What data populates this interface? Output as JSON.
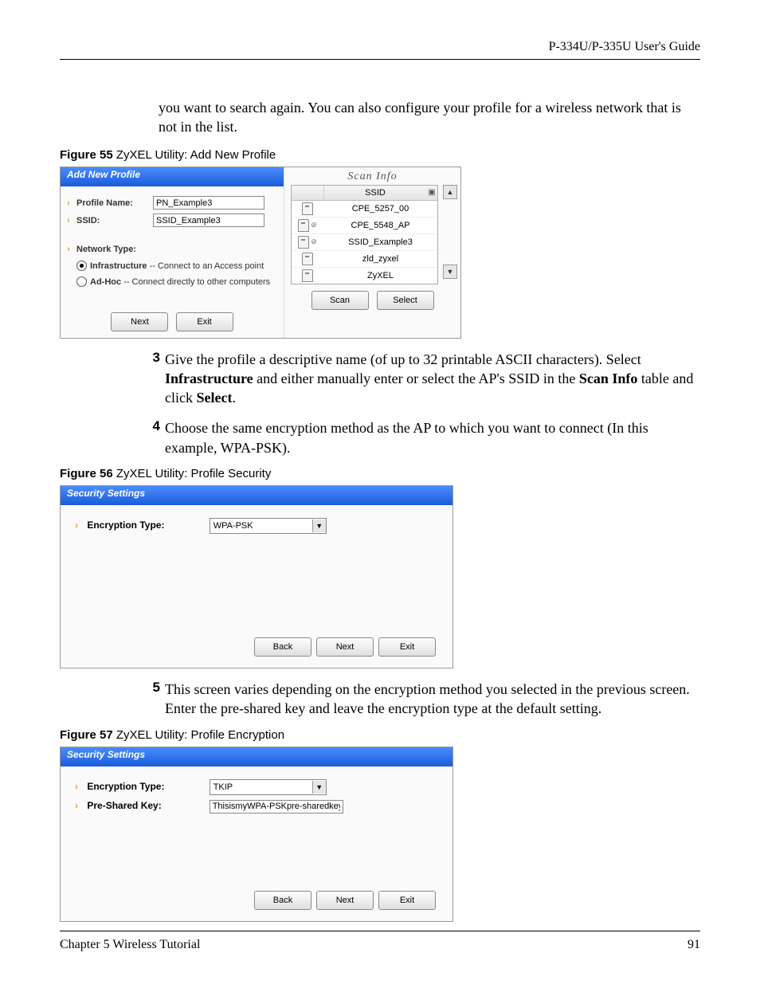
{
  "header": {
    "guide": "P-334U/P-335U User's Guide"
  },
  "intro_continuation": "you want to search again. You can also configure your profile for a wireless network that is not in the list.",
  "fig55": {
    "caption_bold": "Figure 55",
    "caption_rest": "   ZyXEL Utility: Add New Profile",
    "left": {
      "title": "Add New Profile",
      "profile_name_label": "Profile Name:",
      "profile_name_value": "PN_Example3",
      "ssid_label": "SSID:",
      "ssid_value": "SSID_Example3",
      "network_type_label": "Network Type:",
      "radio_infra_bold": "Infrastructure",
      "radio_infra_rest": " -- Connect to an Access point",
      "radio_adhoc_bold": "Ad-Hoc",
      "radio_adhoc_rest": " -- Connect directly to other computers",
      "next": "Next",
      "exit": "Exit"
    },
    "right": {
      "title": "Scan Info",
      "col_ssid": "SSID",
      "rows": [
        {
          "ssid": "CPE_5257_00",
          "locked": false
        },
        {
          "ssid": "CPE_5548_AP",
          "locked": true
        },
        {
          "ssid": "SSID_Example3",
          "locked": true
        },
        {
          "ssid": "zld_zyxel",
          "locked": false
        },
        {
          "ssid": "ZyXEL",
          "locked": false
        }
      ],
      "scan": "Scan",
      "select": "Select"
    }
  },
  "step3": {
    "num": "3",
    "t1": "Give the profile a descriptive name (of up to 32 printable ASCII characters). Select ",
    "b1": "Infrastructure",
    "t2": " and either manually enter or select the AP's SSID in the ",
    "b2": "Scan Info",
    "t3": " table and click ",
    "b3": "Select",
    "t4": "."
  },
  "step4": {
    "num": "4",
    "text": "Choose the same encryption method as the AP to which you want to connect (In this example, WPA-PSK)."
  },
  "fig56": {
    "caption_bold": "Figure 56",
    "caption_rest": "   ZyXEL Utility: Profile Security",
    "title": "Security Settings",
    "enc_label": "Encryption Type:",
    "enc_value": "WPA-PSK",
    "back": "Back",
    "next": "Next",
    "exit": "Exit"
  },
  "step5": {
    "num": "5",
    "text": "This screen varies depending on the encryption method you selected in the previous screen. Enter the pre-shared key and leave the encryption type at the default setting."
  },
  "fig57": {
    "caption_bold": "Figure 57",
    "caption_rest": "   ZyXEL Utility: Profile Encryption",
    "title": "Security Settings",
    "enc_label": "Encryption Type:",
    "enc_value": "TKIP",
    "psk_label": "Pre-Shared Key:",
    "psk_value": "ThisismyWPA-PSKpre-sharedkey",
    "back": "Back",
    "next": "Next",
    "exit": "Exit"
  },
  "footer": {
    "chapter": "Chapter 5 Wireless Tutorial",
    "page": "91"
  }
}
